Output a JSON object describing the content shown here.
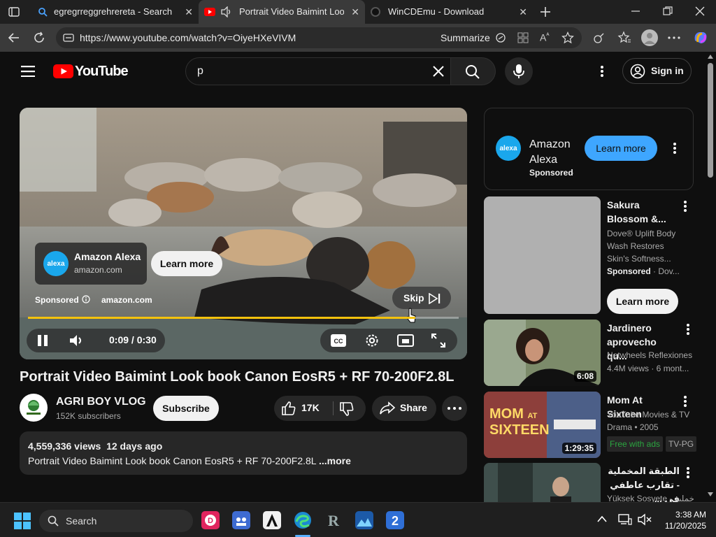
{
  "browser": {
    "tabs": [
      {
        "title": "egregrreggrehrereta - Search"
      },
      {
        "title": "Portrait Video Baimint Look b"
      },
      {
        "title": "WinCDEmu - Download"
      }
    ],
    "url": "https://www.youtube.com/watch?v=OiyeHXeVIVM",
    "summarize_label": "Summarize"
  },
  "youtube": {
    "logo_text": "YouTube",
    "search_query": "p",
    "signin_label": "Sign in"
  },
  "player": {
    "ad_overlay": {
      "advertiser": "Amazon Alexa",
      "domain": "amazon.com",
      "cta": "Learn more",
      "logo_text": "alexa"
    },
    "sponsored_label": "Sponsored",
    "sponsored_domain": "amazon.com",
    "skip_label": "Skip",
    "time_current": "0:09",
    "time_separator": " / ",
    "time_total": "0:30",
    "progress_fraction": 0.9
  },
  "video": {
    "title": "Portrait Video Baimint Look book Canon EosR5 + RF 70-200F2.8L",
    "channel_name": "AGRI BOY VLOG",
    "channel_subs": "152K subscribers",
    "subscribe_label": "Subscribe",
    "likes": "17K",
    "share_label": "Share",
    "views": "4,559,336 views",
    "age": "12 days ago",
    "description": "Portrait Video Baimint Look book Canon EosR5 + RF 70-200F2.8L",
    "more_label": "...more"
  },
  "sidebar": {
    "ad": {
      "name_line1": "Amazon",
      "name_line2": "Alexa",
      "sponsored": "Sponsored",
      "sponsored_dot": " ·",
      "cta": "Learn more",
      "logo_text": "alexa"
    },
    "items": [
      {
        "title": "Sakura Blossom &...",
        "meta1": "Dove® Uplift Body",
        "meta2": "Wash Restores",
        "meta3": "Skin's Softness...",
        "sponsored": "Sponsored",
        "channel": " · Dov...",
        "cta": "Learn more"
      },
      {
        "title": "Jardinero aprovecho qu...",
        "channel": "Netwheels Reflexiones",
        "stats": "4.4M views · 6 mont...",
        "duration": "6:08"
      },
      {
        "title": "Mom At Sixteen",
        "channel": "YouTube Movies & TV",
        "stats": "Drama • 2005",
        "badge1": "Free with ads",
        "badge2": "TV-PG",
        "duration": "1:29:35",
        "thumb_text_1": "MOM",
        "thumb_text_2": "AT",
        "thumb_text_3": "SIXTEEN"
      },
      {
        "title": "الطبقة المخملية - تقارب عاطفي في ...",
        "channel": "Yüksek Sosyete - خمليه"
      }
    ]
  },
  "taskbar": {
    "search_label": "Search",
    "time": "3:38 AM",
    "date": "11/20/2025"
  },
  "colors": {
    "accent_red": "#ff0000",
    "progress_yellow": "#f4c20d",
    "alexa_blue": "#1aa7ec",
    "learn_more_blue": "#3ea6ff",
    "free_green": "#2ba640"
  }
}
